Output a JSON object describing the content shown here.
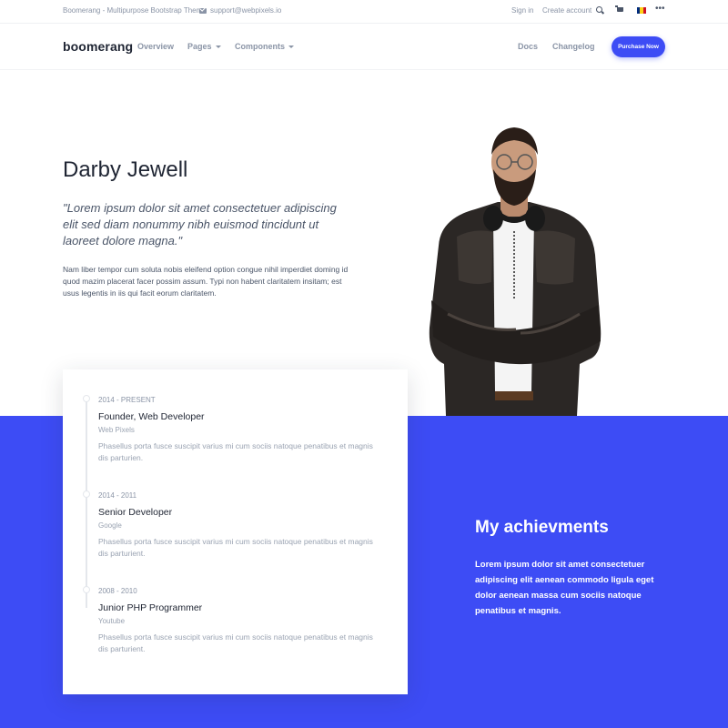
{
  "topbar": {
    "brand_text": "Boomerang - Multipurpose Bootstrap Theme",
    "email": "support@webpixels.io",
    "sign_in": "Sign in",
    "create_account": "Create account",
    "more": "•••",
    "flag_colors": [
      "#002b7f",
      "#fcd116",
      "#ce1126"
    ]
  },
  "navbar": {
    "logo": "boomerang",
    "items": [
      {
        "label": "Overview",
        "has_caret": false
      },
      {
        "label": "Pages",
        "has_caret": true
      },
      {
        "label": "Components",
        "has_caret": true
      }
    ],
    "right_items": [
      {
        "label": "Docs"
      },
      {
        "label": "Changelog"
      }
    ],
    "cta": "Purchase Now",
    "accent_color": "#3d4cf5"
  },
  "hero": {
    "name": "Darby Jewell",
    "quote": "\"Lorem ipsum dolor sit amet consectetuer adipiscing elit sed diam nonummy nibh euismod tincidunt ut laoreet dolore magna.\"",
    "bio": "Nam liber tempor cum soluta nobis eleifend option congue nihil imperdiet doming id quod mazim placerat facer possim assum. Typi non habent claritatem insitam; est usus legentis in iis qui facit eorum claritatem."
  },
  "timeline": [
    {
      "date": "2014 - PRESENT",
      "role": "Founder, Web Developer",
      "company": "Web Pixels",
      "description": "Phasellus porta fusce suscipit varius mi cum sociis natoque penatibus et magnis dis parturien."
    },
    {
      "date": "2014 - 2011",
      "role": "Senior Developer",
      "company": "Google",
      "description": "Phasellus porta fusce suscipit varius mi cum sociis natoque penatibus et magnis dis parturient."
    },
    {
      "date": "2008 - 2010",
      "role": "Junior PHP Programmer",
      "company": "Youtube",
      "description": "Phasellus porta fusce suscipit varius mi cum sociis natoque penatibus et magnis dis parturient."
    }
  ],
  "achievements": {
    "title": "My achievments",
    "text": "Lorem ipsum dolor sit amet consectetuer adipiscing elit aenean commodo ligula eget dolor aenean massa cum sociis natoque penatibus et magnis."
  }
}
